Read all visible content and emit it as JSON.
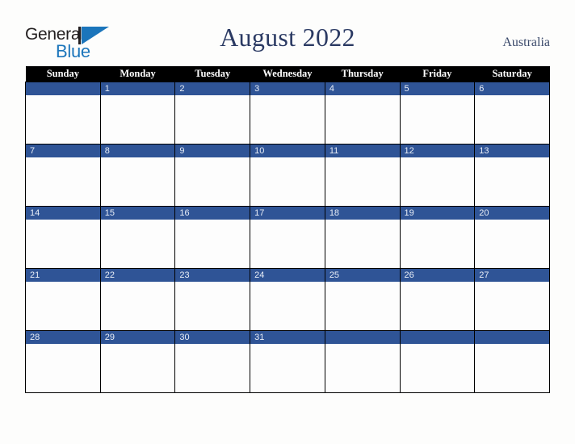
{
  "brand": {
    "name_part1": "General",
    "name_part2": "Blue",
    "mark_icon": "triangle-flag-icon",
    "colors": {
      "dark": "#231f20",
      "blue": "#1b75bb"
    }
  },
  "header": {
    "title": "August 2022",
    "country": "Australia",
    "title_color": "#2b3a63"
  },
  "calendar": {
    "weekday_headers": [
      "Sunday",
      "Monday",
      "Tuesday",
      "Wednesday",
      "Thursday",
      "Friday",
      "Saturday"
    ],
    "header_background": "#000000",
    "header_text_color": "#ffffff",
    "date_band_color": "#2f5496",
    "date_text_color": "#e9eef7",
    "cell_background": "#fdfdfd",
    "grid_line_color": "#000000",
    "weeks": [
      {
        "days": [
          {
            "num": ""
          },
          {
            "num": "1"
          },
          {
            "num": "2"
          },
          {
            "num": "3"
          },
          {
            "num": "4"
          },
          {
            "num": "5"
          },
          {
            "num": "6"
          }
        ]
      },
      {
        "days": [
          {
            "num": "7"
          },
          {
            "num": "8"
          },
          {
            "num": "9"
          },
          {
            "num": "10"
          },
          {
            "num": "11"
          },
          {
            "num": "12"
          },
          {
            "num": "13"
          }
        ]
      },
      {
        "days": [
          {
            "num": "14"
          },
          {
            "num": "15"
          },
          {
            "num": "16"
          },
          {
            "num": "17"
          },
          {
            "num": "18"
          },
          {
            "num": "19"
          },
          {
            "num": "20"
          }
        ]
      },
      {
        "days": [
          {
            "num": "21"
          },
          {
            "num": "22"
          },
          {
            "num": "23"
          },
          {
            "num": "24"
          },
          {
            "num": "25"
          },
          {
            "num": "26"
          },
          {
            "num": "27"
          }
        ]
      },
      {
        "days": [
          {
            "num": "28"
          },
          {
            "num": "29"
          },
          {
            "num": "30"
          },
          {
            "num": "31"
          },
          {
            "num": ""
          },
          {
            "num": ""
          },
          {
            "num": ""
          }
        ]
      }
    ]
  }
}
